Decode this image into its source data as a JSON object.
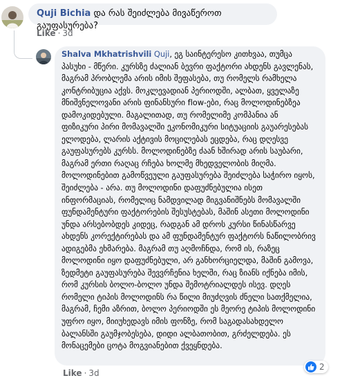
{
  "top_comment": {
    "author": "Quji Bichia",
    "text": "და რას შეიძლება მივაწეროთ გაუფასურება?",
    "actions": {
      "like_label": "Like",
      "separator": "·",
      "time": "3d"
    }
  },
  "reply": {
    "author": "Shalva Mkhatrishvili",
    "mention": "Quji",
    "text": ", ეგ საინტერესო კითხვაა, თუმცა პასუხი - მწერი. კურსზე ძალიან ბევრი ფაქტორი ახდენს გავლენას, მაგრამ პრობლემა არის იმის შეფასება, თუ რომელს რამხელა კონტრიბუცია აქვს. მოკლევადიან პერიოდში, ალბათ, ყველაზე მნიშვნელოვანი არის ფინანსური flow-ები, რაც მოლოდინებზეა დამოკიდებული. მაგალითად, თუ რომელიმე კომპანია ან ფიზიკური პირი მომავალში ეკონომიკური სიტუაციის გაუარესებას ელოდება, ლარის აქტივის მოცილებას ეცდება, რაც დღესვე გაუფასურებს კურსს. მოლოდინებზე ძაან ხშირად არის საუბარი, მაგრამ ერთი რაღაც რჩება ხოლმე მხედველობის მიღმა. მოლოდინებით გამოწვეული გაუფასურება შეიძლება საჭირო იყოს, შეიძლება - არა. თუ მოლოდინი დაფუძნებულია ისეთ ინფორმაციას, რომელიც ნამდვილად მიგვანიშნებს მომავალში ფუნდამენტური ფაქტორების შესუსტებას, მაშინ ასეთი მოლოდინი უნდა არსებობდეს კიდეც, რადგან ამ დროს კურსი წინასწარვე ახდენს კორექტირებას და ამ ფუნდამენტურ ფაქტორს ნაწილობრივ ადიგებმა ეხმარება. მაგრამ თუ აღმოჩნდა, რომ ის, რაზეც მოლოდინი იყო დაფუძნებული, არ განხორციელდა, მაშინ გამოვა, ზედმეტი გაუფასურება შევვრჩენია ხელში, რაც ზიანს იქნება იმის, რომ კურსის ბოლო-ბოლო უნდა შემოტრიალდეს ისევ. დღეს რომელი ტიპის მოლოდინს რა წილი მიუძღვის ძნელი სათქმელია, მაგრამ, ჩემი აზრით, ბოლო პერიოდში ეს მეორე ტიპის მოლოდინი უფრო იყო, მიიუხედავს იმის ფონზე, რომ საგადასახდელო ბალანსში გაუმჯობესება, დიდი ალბათობით, გრძელდება. ეს მონაცემები ცოტა მოგვიანებით ქვეყნდება.",
    "actions": {
      "like_label": "Like",
      "separator": "·",
      "time": "3d"
    },
    "reaction_count": "2"
  },
  "colors": {
    "link": "#385898",
    "bubble": "#f0f2f5",
    "meta": "#65676b",
    "like_blue": "#1877f2"
  },
  "icons": [
    "avatar-quji",
    "avatar-shalva",
    "like-reaction-icon"
  ]
}
